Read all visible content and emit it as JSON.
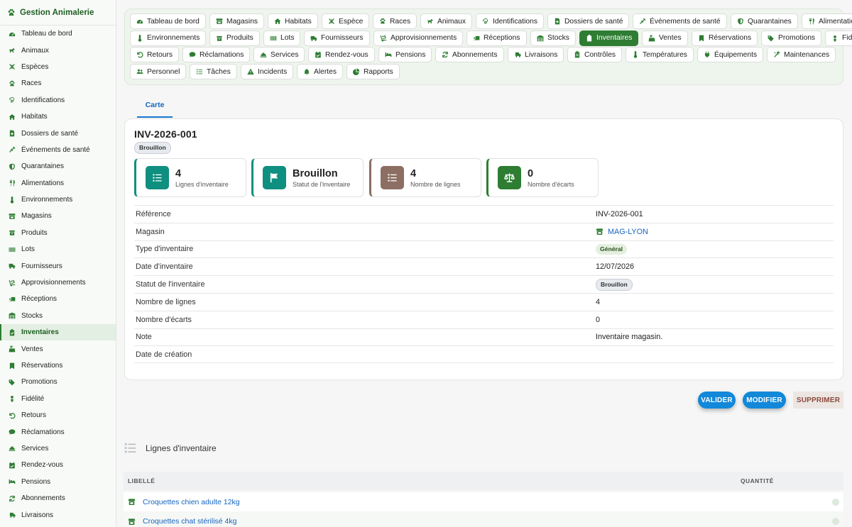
{
  "app": {
    "title": "Gestion Animalerie",
    "logo_icon": "paw-icon"
  },
  "sidebar": {
    "active": "Inventaires",
    "items": [
      {
        "label": "Tableau de bord",
        "icon": "dashboard-icon"
      },
      {
        "label": "Animaux",
        "icon": "dog-icon"
      },
      {
        "label": "Espèces",
        "icon": "dna-icon"
      },
      {
        "label": "Races",
        "icon": "paw-icon"
      },
      {
        "label": "Identifications",
        "icon": "fingerprint-icon"
      },
      {
        "label": "Habitats",
        "icon": "house-icon"
      },
      {
        "label": "Dossiers de santé",
        "icon": "file-medical-icon"
      },
      {
        "label": "Événements de santé",
        "icon": "syringe-icon"
      },
      {
        "label": "Quarantaines",
        "icon": "shield-icon"
      },
      {
        "label": "Alimentations",
        "icon": "utensils-icon"
      },
      {
        "label": "Environnements",
        "icon": "thermometer-icon"
      },
      {
        "label": "Magasins",
        "icon": "store-icon"
      },
      {
        "label": "Produits",
        "icon": "box-icon"
      },
      {
        "label": "Lots",
        "icon": "barcode-icon"
      },
      {
        "label": "Fournisseurs",
        "icon": "truck-icon"
      },
      {
        "label": "Approvisionnements",
        "icon": "dolly-icon"
      },
      {
        "label": "Réceptions",
        "icon": "truck-ramp-icon"
      },
      {
        "label": "Stocks",
        "icon": "warehouse-icon"
      },
      {
        "label": "Inventaires",
        "icon": "clipboard-check-icon"
      },
      {
        "label": "Ventes",
        "icon": "cash-register-icon"
      },
      {
        "label": "Réservations",
        "icon": "bookmark-icon"
      },
      {
        "label": "Promotions",
        "icon": "tags-icon"
      },
      {
        "label": "Fidélité",
        "icon": "user-tag-icon"
      },
      {
        "label": "Retours",
        "icon": "undo-icon"
      },
      {
        "label": "Réclamations",
        "icon": "comment-icon"
      },
      {
        "label": "Services",
        "icon": "bell-concierge-icon"
      },
      {
        "label": "Rendez-vous",
        "icon": "calendar-check-icon"
      },
      {
        "label": "Pensions",
        "icon": "bed-icon"
      },
      {
        "label": "Abonnements",
        "icon": "sync-icon"
      },
      {
        "label": "Livraisons",
        "icon": "shipping-fast-icon"
      }
    ]
  },
  "tabs": {
    "active": "Inventaires",
    "items": [
      {
        "label": "Tableau de bord",
        "icon": "dashboard-icon"
      },
      {
        "label": "Magasins",
        "icon": "store-icon"
      },
      {
        "label": "Habitats",
        "icon": "house-icon"
      },
      {
        "label": "Espèce",
        "icon": "dna-icon"
      },
      {
        "label": "Races",
        "icon": "paw-icon"
      },
      {
        "label": "Animaux",
        "icon": "dog-icon"
      },
      {
        "label": "Identifications",
        "icon": "fingerprint-icon"
      },
      {
        "label": "Dossiers de santé",
        "icon": "file-medical-icon"
      },
      {
        "label": "Événements de santé",
        "icon": "syringe-icon"
      },
      {
        "label": "Quarantaines",
        "icon": "shield-icon"
      },
      {
        "label": "Alimentations",
        "icon": "utensils-icon"
      },
      {
        "label": "Environnements",
        "icon": "thermometer-icon"
      },
      {
        "label": "Produits",
        "icon": "box-icon"
      },
      {
        "label": "Lots",
        "icon": "barcode-icon"
      },
      {
        "label": "Fournisseurs",
        "icon": "truck-icon"
      },
      {
        "label": "Approvisionnements",
        "icon": "dolly-icon"
      },
      {
        "label": "Réceptions",
        "icon": "truck-ramp-icon"
      },
      {
        "label": "Stocks",
        "icon": "warehouse-icon"
      },
      {
        "label": "Inventaires",
        "icon": "clipboard-check-icon"
      },
      {
        "label": "Ventes",
        "icon": "cash-register-icon"
      },
      {
        "label": "Réservations",
        "icon": "bookmark-icon"
      },
      {
        "label": "Promotions",
        "icon": "tags-icon"
      },
      {
        "label": "Fidélité",
        "icon": "user-tag-icon"
      },
      {
        "label": "Retours",
        "icon": "undo-icon"
      },
      {
        "label": "Réclamations",
        "icon": "comment-icon"
      },
      {
        "label": "Services",
        "icon": "bell-concierge-icon"
      },
      {
        "label": "Rendez-vous",
        "icon": "calendar-check-icon"
      },
      {
        "label": "Pensions",
        "icon": "bed-icon"
      },
      {
        "label": "Abonnements",
        "icon": "sync-icon"
      },
      {
        "label": "Livraisons",
        "icon": "shipping-fast-icon"
      },
      {
        "label": "Contrôles",
        "icon": "clipboard-icon"
      },
      {
        "label": "Températures",
        "icon": "thermometer-icon"
      },
      {
        "label": "Équipements",
        "icon": "plug-icon"
      },
      {
        "label": "Maintenances",
        "icon": "tools-icon"
      },
      {
        "label": "Personnel",
        "icon": "users-icon"
      },
      {
        "label": "Tâches",
        "icon": "list-icon"
      },
      {
        "label": "Incidents",
        "icon": "warning-icon"
      },
      {
        "label": "Alertes",
        "icon": "bell-icon"
      },
      {
        "label": "Rapports",
        "icon": "chart-pie-icon"
      }
    ]
  },
  "view_tab": {
    "label": "Carte"
  },
  "inventory": {
    "title": "INV-2026-001",
    "status_badge": "Brouillon",
    "stats": [
      {
        "value": "4",
        "label": "Lignes d'inventaire",
        "icon": "list-icon",
        "color": "#0f8f80"
      },
      {
        "value": "Brouillon",
        "label": "Statut de l'inventaire",
        "icon": "flag-icon",
        "color": "#0f8f80"
      },
      {
        "value": "4",
        "label": "Nombre de lignes",
        "icon": "list-icon",
        "color": "#8d6e63"
      },
      {
        "value": "0",
        "label": "Nombre d'écarts",
        "icon": "balance-scale-icon",
        "color": "#2e7d32"
      }
    ],
    "fields": [
      {
        "label": "Référence",
        "value": "INV-2026-001",
        "kind": "text"
      },
      {
        "label": "Magasin",
        "value": "MAG-LYON",
        "kind": "link"
      },
      {
        "label": "Type d'inventaire",
        "value": "Général",
        "kind": "badge-green"
      },
      {
        "label": "Date d'inventaire",
        "value": "12/07/2026",
        "kind": "text"
      },
      {
        "label": "Statut de l'inventaire",
        "value": "Brouillon",
        "kind": "badge-grey"
      },
      {
        "label": "Nombre de lignes",
        "value": "4",
        "kind": "text"
      },
      {
        "label": "Nombre d'écarts",
        "value": "0",
        "kind": "text"
      },
      {
        "label": "Note",
        "value": "Inventaire magasin.",
        "kind": "text"
      },
      {
        "label": "Date de création",
        "value": "",
        "kind": "text"
      }
    ]
  },
  "actions": {
    "validate": "VALIDER",
    "edit": "MODIFIER",
    "delete": "SUPPRIMER"
  },
  "lines": {
    "title": "Lignes d'inventaire",
    "columns": {
      "label": "LIBELLÉ",
      "quantity": "QUANTITÉ"
    },
    "rows": [
      {
        "label": "Croquettes chien adulte 12kg"
      },
      {
        "label": "Croquettes chat stérilisé 4kg"
      }
    ]
  },
  "colors": {
    "primary": "#2e7d32",
    "accent_blue": "#1288d9",
    "teal": "#0f8f80",
    "brown": "#8d6e63"
  }
}
